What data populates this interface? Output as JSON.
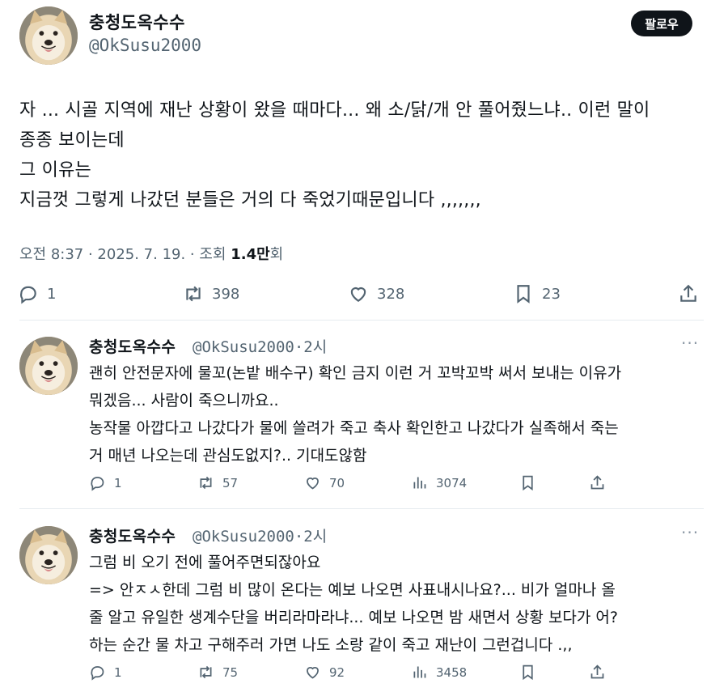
{
  "main_tweet": {
    "display_name": "충청도옥수수",
    "handle": "@OkSusu2000",
    "follow_label": "팔로우",
    "text": "자 ... 시골 지역에 재난 상황이 왔을 때마다... 왜 소/닭/개 안 풀어줬느냐.. 이런 말이\n종종 보이는데\n그 이유는\n지금껏 그렇게 나갔던 분들은 거의 다 죽었기때문입니다 ,,,,,,,",
    "meta_prefix": "오전 8:37 · 2025. 7. 19. · 조회 ",
    "meta_views": "1.4만",
    "meta_suffix": "회",
    "stats": {
      "replies": "1",
      "retweets": "398",
      "likes": "328",
      "bookmarks": "23"
    }
  },
  "replies": [
    {
      "display_name": "충청도옥수수",
      "handle_time": "@OkSusu2000·2시",
      "more": "···",
      "text": "괜히 안전문자에 물꼬(논밭 배수구) 확인 금지 이런 거 꼬박꼬박 써서 보내는 이유가\n뭐겠음... 사람이 죽으니까요..\n농작물 아깝다고 나갔다가 물에 쓸려가 죽고 축사 확인한고 나갔다가 실족해서 죽는\n거 매년 나오는데 관심도없지?.. 기대도않함",
      "stats": {
        "replies": "1",
        "retweets": "57",
        "likes": "70",
        "views": "3074"
      }
    },
    {
      "display_name": "충청도옥수수",
      "handle_time": "@OkSusu2000·2시",
      "more": "···",
      "text": "그럼 비 오기 전에 풀어주면되잖아요\n=> 안ㅈㅅ한데 그럼 비 많이 온다는 예보 나오면 사표내시나요?... 비가 얼마나 올\n줄 알고 유일한 생계수단을 버리라마라냐... 예보 나오면 밤 새면서 상황 보다가 어?\n하는 순간 물 차고 구해주러 가면 나도 소랑 같이 죽고 재난이 그런겁니다 .,,",
      "stats": {
        "replies": "1",
        "retweets": "75",
        "likes": "92",
        "views": "3458"
      }
    }
  ]
}
